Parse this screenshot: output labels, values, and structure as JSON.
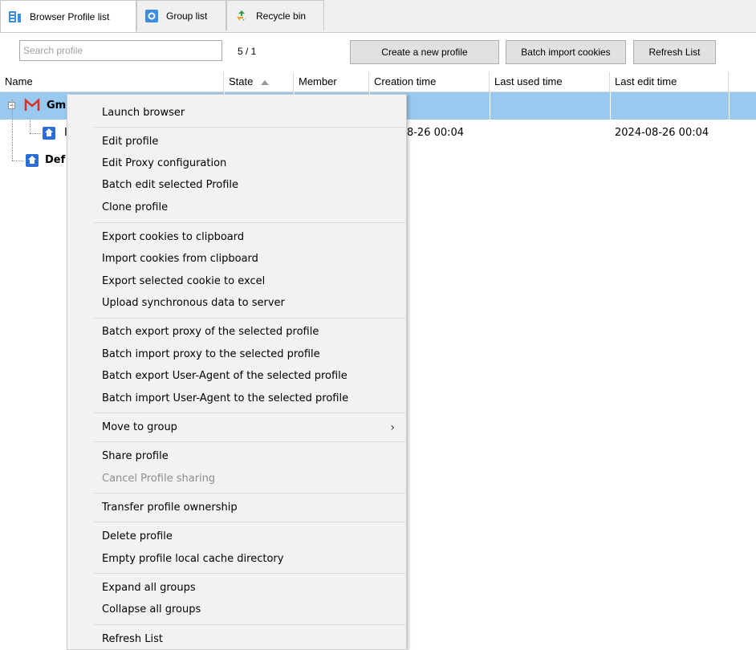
{
  "tabs": [
    {
      "label": "Browser Profile list",
      "icon": "profile-list-icon"
    },
    {
      "label": "Group list",
      "icon": "group-list-icon"
    },
    {
      "label": "Recycle bin",
      "icon": "recycle-bin-icon"
    }
  ],
  "toolbar": {
    "search_placeholder": "Search profile",
    "search_value": "",
    "pager": "5 / 1",
    "create_label": "Create a new profile",
    "batch_import_label": "Batch import cookies",
    "refresh_label": "Refresh List"
  },
  "grid": {
    "columns": [
      "Name",
      "State",
      "Member",
      "Creation time",
      "Last used time",
      "Last edit time"
    ],
    "sort_column": "State",
    "rows": [
      {
        "name": "Gm",
        "state": "",
        "member": "",
        "creation": "",
        "last_used": "",
        "last_edit": ""
      },
      {
        "name": "I",
        "state": "",
        "member": "",
        "creation": "-08-26 00:04",
        "last_used": "",
        "last_edit": "2024-08-26 00:04"
      },
      {
        "name": "Def",
        "state": "",
        "member": "",
        "creation": "",
        "last_used": "",
        "last_edit": ""
      }
    ]
  },
  "menu": {
    "items": [
      {
        "label": "Launch browser"
      },
      {
        "label": "Edit profile"
      },
      {
        "label": "Edit Proxy configuration"
      },
      {
        "label": "Batch edit selected Profile"
      },
      {
        "label": "Clone profile"
      },
      {
        "label": "Export cookies to clipboard"
      },
      {
        "label": "Import cookies from clipboard"
      },
      {
        "label": "Export selected cookie to excel"
      },
      {
        "label": "Upload synchronous data to server"
      },
      {
        "label": "Batch export proxy of the selected profile"
      },
      {
        "label": "Batch import proxy to the selected profile"
      },
      {
        "label": "Batch export User-Agent of the selected profile"
      },
      {
        "label": "Batch import User-Agent to the selected profile"
      },
      {
        "label": "Move to group",
        "submenu": true
      },
      {
        "label": "Share profile"
      },
      {
        "label": "Cancel Profile sharing",
        "disabled": true
      },
      {
        "label": "Transfer profile ownership"
      },
      {
        "label": "Delete profile"
      },
      {
        "label": "Empty profile local cache directory"
      },
      {
        "label": "Expand all groups"
      },
      {
        "label": "Collapse all groups"
      },
      {
        "label": "Refresh List"
      }
    ],
    "submenu_glyph": "›"
  },
  "colors": {
    "selection": "#99c9ee",
    "gmail_red": "#d93025",
    "home_blue": "#2b6fd6"
  }
}
